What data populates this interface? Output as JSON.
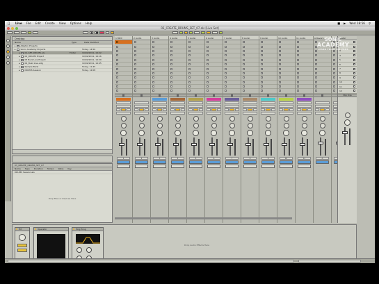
{
  "menubar": {
    "app_name": "Live",
    "items": [
      "File",
      "Edit",
      "Create",
      "View",
      "Options",
      "Help"
    ],
    "clock": "Wed 18:56"
  },
  "window": {
    "title": "03_CREATE_DRUMS_SET_07.als [Live Set]"
  },
  "transport": {
    "record_color": "#e0395b",
    "accent_yellow": "#e9c53a",
    "accent_green": "#b8d14a",
    "accent_orange": "#f0b422"
  },
  "logo": {
    "line1": "SONIC",
    "line2": "ACADEMY",
    "line3": "LEARN FROM THE PROS"
  },
  "browser": {
    "header": "Desktop",
    "columns": [
      "Name",
      "Type",
      "Date Modified"
    ],
    "rows": [
      {
        "name": "Ableton Projects",
        "type": "",
        "date": "",
        "selected": false
      },
      {
        "name": "Sonic Academy Projects",
        "type": "",
        "date": "Today, 14:56",
        "selected": false
      },
      {
        "name": "01_SET_DRUMS.als",
        "type": "Folder",
        "date": "10/02/2011, 14:22",
        "selected": true
      },
      {
        "name": "02_DRUMS Project",
        "type": "",
        "date": "10/02/2011, 14:16",
        "selected": false
      },
      {
        "name": "03 Buzz Live Project",
        "type": "",
        "date": "10/02/2011, 14:29",
        "selected": false
      },
      {
        "name": "04_Buzz Live.adg",
        "type": "",
        "date": "10/02/2011, 14:45",
        "selected": false
      },
      {
        "name": "Sample Bank",
        "type": "",
        "date": "Today, 11:45",
        "selected": false
      },
      {
        "name": "DRUMS Session",
        "type": "",
        "date": "Today, 12:08",
        "selected": false
      }
    ]
  },
  "clip_view": {
    "title": "03_CREATE_DRUMS_SET_07",
    "columns": [
      "Name",
      "Type",
      "Duration",
      "Tempo",
      "Warp",
      "Key"
    ],
    "row": "DRUMS Session.als",
    "drop_text": "Drop Files or Devices Here"
  },
  "tracks": [
    {
      "name": "1 MIDI",
      "color": "#d7701f",
      "has_clip": true,
      "number": "1"
    },
    {
      "name": "2 Audio",
      "color": "",
      "has_clip": false,
      "number": "2"
    },
    {
      "name": "3 Audio",
      "color": "#5b9cd6",
      "has_clip": false,
      "number": "3"
    },
    {
      "name": "4 Audio",
      "color": "#a6693a",
      "has_clip": false,
      "number": "4"
    },
    {
      "name": "5 Audio",
      "color": "#b3a14c",
      "has_clip": false,
      "number": "5"
    },
    {
      "name": "6 Audio",
      "color": "#d43e9b",
      "has_clip": false,
      "number": "6"
    },
    {
      "name": "7 Audio",
      "color": "#6a5f9a",
      "has_clip": false,
      "number": "7"
    },
    {
      "name": "8 Audio",
      "color": "#a98a6a",
      "has_clip": false,
      "number": "8"
    },
    {
      "name": "9 Audio",
      "color": "#4ec9c9",
      "has_clip": false,
      "number": "9"
    },
    {
      "name": "10 Audio",
      "color": "#b8d14a",
      "has_clip": false,
      "number": "10"
    },
    {
      "name": "11 Audio",
      "color": "#8e4fbf",
      "has_clip": false,
      "number": "11"
    }
  ],
  "returns": [
    {
      "name": "A Reverb",
      "letter": "A"
    },
    {
      "name": "B Delay",
      "letter": "B"
    }
  ],
  "master": {
    "name": "Master",
    "scenes": [
      "1",
      "2",
      "3",
      "4",
      "5",
      "6",
      "7",
      "8",
      "9",
      "10",
      "11",
      "12"
    ],
    "stop_all": "Stop Clips"
  },
  "detail": {
    "device1": {
      "name": "Hit"
    },
    "device2": {
      "name": "Operator"
    },
    "device3": {
      "name": "Ping Pong"
    },
    "drop_text": "Drop Audio Effects Here"
  }
}
